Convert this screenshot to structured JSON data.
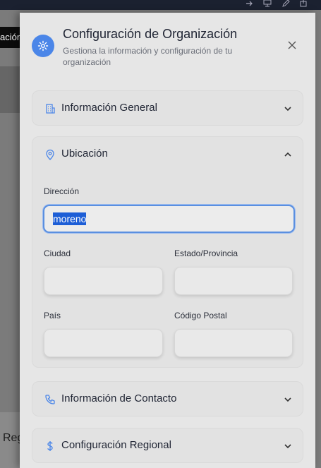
{
  "background": {
    "tab_label": "ación",
    "bottom_text": "Reg"
  },
  "drawer": {
    "title": "Configuración de Organización",
    "subtitle": "Gestiona la información y configuración de tu organización"
  },
  "sections": {
    "general": {
      "label": "Información General",
      "icon": "building-icon",
      "expanded": false
    },
    "location": {
      "label": "Ubicación",
      "icon": "map-pin-icon",
      "expanded": true
    },
    "contact": {
      "label": "Información de Contacto",
      "icon": "phone-icon",
      "expanded": false
    },
    "regional": {
      "label": "Configuración Regional",
      "icon": "dollar-icon",
      "expanded": false
    }
  },
  "location_form": {
    "address": {
      "label": "Dirección",
      "value": "moreno"
    },
    "city": {
      "label": "Ciudad",
      "value": ""
    },
    "state": {
      "label": "Estado/Provincia",
      "value": ""
    },
    "country": {
      "label": "País",
      "value": ""
    },
    "postal": {
      "label": "Código Postal",
      "value": ""
    }
  },
  "colors": {
    "accent": "#4b86e8",
    "selection": "#1d5ed6"
  }
}
